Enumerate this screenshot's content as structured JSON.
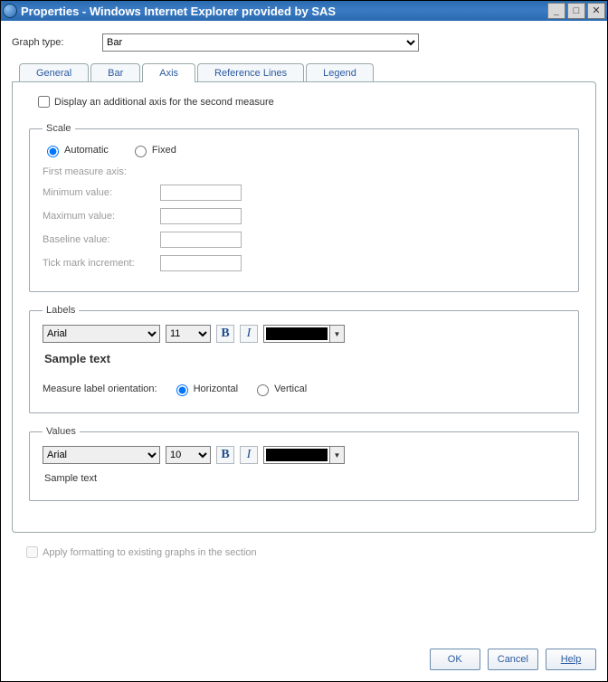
{
  "window": {
    "title": "Properties - Windows Internet Explorer provided by SAS"
  },
  "graphType": {
    "label": "Graph type:",
    "value": "Bar"
  },
  "tabs": {
    "general": "General",
    "bar": "Bar",
    "axis": "Axis",
    "ref": "Reference Lines",
    "legend": "Legend"
  },
  "axis": {
    "displayAdditional": "Display an additional axis for the second measure",
    "scale": {
      "legend": "Scale",
      "automatic": "Automatic",
      "fixed": "Fixed",
      "firstMeasure": "First measure axis:",
      "min": {
        "label": "Minimum value:",
        "value": ""
      },
      "max": {
        "label": "Maximum value:",
        "value": ""
      },
      "baseline": {
        "label": "Baseline value:",
        "value": ""
      },
      "tick": {
        "label": "Tick mark increment:",
        "value": ""
      }
    },
    "labels": {
      "legend": "Labels",
      "font": "Arial",
      "size": "11",
      "sample": "Sample text",
      "orientLabel": "Measure label orientation:",
      "horizontal": "Horizontal",
      "vertical": "Vertical"
    },
    "values": {
      "legend": "Values",
      "font": "Arial",
      "size": "10",
      "sample": "Sample text"
    }
  },
  "bottom": {
    "applyFormatting": "Apply formatting to existing graphs in the section"
  },
  "buttons": {
    "ok": "OK",
    "cancel": "Cancel",
    "help": "Help"
  },
  "bi": {
    "bold": "B",
    "italic": "I"
  }
}
